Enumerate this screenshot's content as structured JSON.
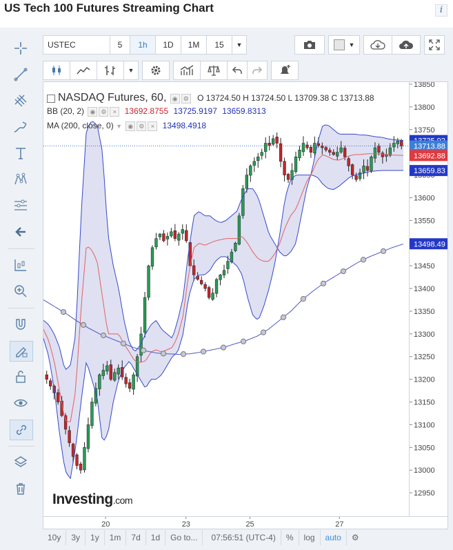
{
  "page": {
    "title": "US Tech 100 Futures Streaming Chart",
    "info_label": "i"
  },
  "toolbar": {
    "symbol": "USTEC",
    "intervals": [
      "5",
      "1h",
      "1D",
      "1M",
      "15"
    ],
    "selected_interval": "1h"
  },
  "legend": {
    "main_name": "NASDAQ Futures, 60,",
    "o": "O 13724.50",
    "h": "H 13724.50",
    "l": "L 13709.38",
    "c": "C 13713.88",
    "bb_name": "BB (20, 2)",
    "bb_mid": "13692.8755",
    "bb_up": "13725.9197",
    "bb_low": "13659.8313",
    "ma_name": "MA (200, close, 0)",
    "ma_val": "13498.4918"
  },
  "logo": {
    "main": "Investing",
    "suffix": ".com"
  },
  "bottom": {
    "ranges": [
      "10y",
      "3y",
      "1y",
      "1m",
      "7d",
      "1d",
      "Go to..."
    ],
    "time": "07:56:51 (UTC-4)",
    "pct": "%",
    "log": "log",
    "auto": "auto"
  },
  "colors": {
    "up": "#2a9a57",
    "down": "#c3262c",
    "bb_band": "#3548c9",
    "bb_mid": "#e06060",
    "fill": "#d9daf0",
    "ma": "#4a56c8",
    "price_last": "#2f6fd0"
  },
  "chart_data": {
    "type": "candlestick",
    "title": "NASDAQ Futures, 60",
    "ylim": [
      12900,
      13850
    ],
    "y_ticks": [
      12950,
      13000,
      13050,
      13100,
      13150,
      13200,
      13250,
      13300,
      13350,
      13400,
      13450,
      13500,
      13550,
      13600,
      13650,
      13700,
      13750,
      13800,
      13850
    ],
    "x_ticks": [
      {
        "label": "20",
        "pos": 0.17
      },
      {
        "label": "23",
        "pos": 0.39
      },
      {
        "label": "25",
        "pos": 0.565
      },
      {
        "label": "27",
        "pos": 0.81
      }
    ],
    "close_series": [
      13200,
      13185,
      13170,
      13150,
      13120,
      13090,
      13060,
      13030,
      13010,
      13000,
      13050,
      13100,
      13150,
      13180,
      13210,
      13220,
      13230,
      13200,
      13215,
      13225,
      13205,
      13190,
      13180,
      13210,
      13250,
      13300,
      13380,
      13450,
      13490,
      13510,
      13520,
      13505,
      13515,
      13525,
      13510,
      13520,
      13530,
      13505,
      13450,
      13430,
      13420,
      13410,
      13400,
      13380,
      13390,
      13420,
      13430,
      13440,
      13460,
      13480,
      13500,
      13560,
      13620,
      13650,
      13670,
      13680,
      13690,
      13700,
      13720,
      13715,
      13730,
      13720,
      13680,
      13650,
      13640,
      13660,
      13690,
      13705,
      13720,
      13710,
      13700,
      13720,
      13715,
      13710,
      13705,
      13700,
      13695,
      13700,
      13710,
      13690,
      13670,
      13650,
      13640,
      13655,
      13670,
      13660,
      13690,
      13710,
      13700,
      13690,
      13695,
      13710,
      13720,
      13725,
      13714
    ],
    "bb_upper_series": [
      13330,
      13320,
      13300,
      13270,
      13220,
      13230,
      13300,
      13560,
      13750,
      13770,
      13760,
      13700,
      13520,
      13450,
      13400,
      13330,
      13280,
      13260,
      13275,
      13300,
      13320,
      13330,
      13310,
      13300,
      13290,
      13330,
      13380,
      13480,
      13560,
      13570,
      13560,
      13560,
      13550,
      13545,
      13550,
      13560,
      13570,
      13600,
      13620,
      13620,
      13600,
      13560,
      13520,
      13500,
      13480,
      13470,
      13480,
      13500,
      13560,
      13620,
      13660,
      13720,
      13760,
      13760,
      13750,
      13740,
      13740,
      13740,
      13740,
      13738,
      13738,
      13736,
      13734,
      13733,
      13730,
      13728,
      13727,
      13726
    ],
    "bb_lower_series": [
      13290,
      13250,
      13180,
      13080,
      13000,
      12980,
      13050,
      13150,
      13240,
      13200,
      13160,
      13060,
      13080,
      13150,
      13200,
      13225,
      13240,
      13220,
      13200,
      13180,
      13200,
      13200,
      13210,
      13230,
      13250,
      13260,
      13300,
      13380,
      13420,
      13430,
      13430,
      13440,
      13460,
      13470,
      13470,
      13460,
      13450,
      13430,
      13380,
      13340,
      13330,
      13360,
      13400,
      13450,
      13520,
      13600,
      13640,
      13650,
      13650,
      13650,
      13650,
      13645,
      13630,
      13620,
      13618,
      13625,
      13635,
      13645,
      13650,
      13652,
      13655,
      13658,
      13659,
      13660,
      13660,
      13660,
      13660,
      13660
    ],
    "ma_series": [
      13375,
      13360,
      13345,
      13328,
      13313,
      13300,
      13290,
      13280,
      13270,
      13263,
      13258,
      13256,
      13255,
      13256,
      13260,
      13265,
      13270,
      13278,
      13285,
      13295,
      13310,
      13330,
      13350,
      13375,
      13395,
      13413,
      13428,
      13443,
      13458,
      13470,
      13480,
      13490,
      13498
    ],
    "ma_markers": 18,
    "series": [
      {
        "name": "BB Upper",
        "last": 13725.92
      },
      {
        "name": "BB Middle",
        "last": 13692.88
      },
      {
        "name": "BB Lower",
        "last": 13659.83
      },
      {
        "name": "MA 200",
        "last": 13498.49
      }
    ],
    "last_price": 13713.88,
    "price_labels": [
      "13725.92",
      "13713.88",
      "13692.88",
      "13659.83",
      "13498.49"
    ]
  }
}
